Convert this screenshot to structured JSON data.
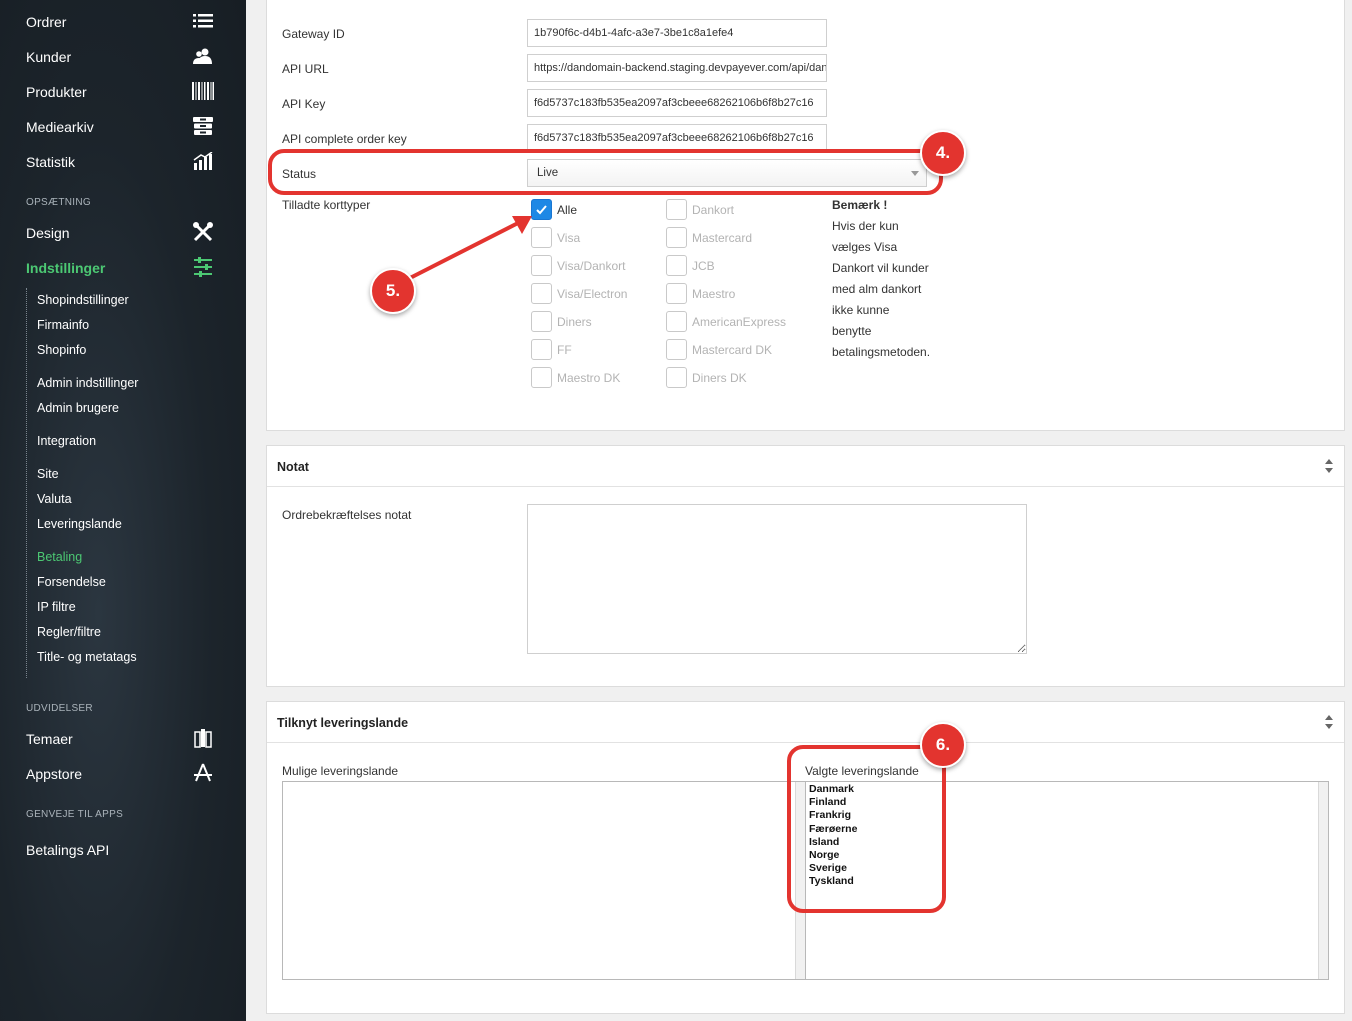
{
  "sidebar": {
    "main": [
      {
        "label": "Ordrer",
        "icon": "list-icon"
      },
      {
        "label": "Kunder",
        "icon": "users-icon"
      },
      {
        "label": "Produkter",
        "icon": "barcode-icon"
      },
      {
        "label": "Mediearkiv",
        "icon": "archive-icon"
      },
      {
        "label": "Statistik",
        "icon": "chart-icon"
      }
    ],
    "section_setup": "OPSÆTNING",
    "design": {
      "label": "Design",
      "icon": "tools-icon"
    },
    "settings": {
      "label": "Indstillinger",
      "icon": "sliders-icon"
    },
    "sub_items": [
      "Shopindstillinger",
      "Firmainfo",
      "Shopinfo",
      "Admin indstillinger",
      "Admin brugere",
      "Integration",
      "Site",
      "Valuta",
      "Leveringslande",
      "Betaling",
      "Forsendelse",
      "IP filtre",
      "Regler/filtre",
      "Title- og metatags"
    ],
    "section_ext": "UDVIDELSER",
    "themes": {
      "label": "Temaer",
      "icon": "theme-icon"
    },
    "appstore": {
      "label": "Appstore",
      "icon": "appstore-icon"
    },
    "section_shortcuts": "GENVEJE TIL APPS",
    "shortcut": "Betalings API",
    "accent": "#4cc873"
  },
  "gateway": {
    "fields": [
      {
        "label": "Gateway ID",
        "value": "1b790f6c-d4b1-4afc-a3e7-3be1c8a1efe4"
      },
      {
        "label": "API URL",
        "value": "https://dandomain-backend.staging.devpayever.com/api/dandomain"
      },
      {
        "label": "API Key",
        "value": "f6d5737c183fb535ea2097af3cbeee68262106b6f8b27c16"
      },
      {
        "label": "API complete order key",
        "value": "f6d5737c183fb535ea2097af3cbeee68262106b6f8b27c16"
      }
    ],
    "status_label": "Status",
    "status_value": "Live",
    "cards_label": "Tilladte korttyper",
    "cards_col1": [
      {
        "label": "Alle",
        "checked": true
      },
      {
        "label": "Visa",
        "checked": false
      },
      {
        "label": "Visa/Dankort",
        "checked": false
      },
      {
        "label": "Visa/Electron",
        "checked": false
      },
      {
        "label": "Diners",
        "checked": false
      },
      {
        "label": "FF",
        "checked": false
      },
      {
        "label": "Maestro DK",
        "checked": false
      }
    ],
    "cards_col2": [
      {
        "label": "Dankort",
        "checked": false
      },
      {
        "label": "Mastercard",
        "checked": false
      },
      {
        "label": "JCB",
        "checked": false
      },
      {
        "label": "Maestro",
        "checked": false
      },
      {
        "label": "AmericanExpress",
        "checked": false
      },
      {
        "label": "Mastercard DK",
        "checked": false
      },
      {
        "label": "Diners DK",
        "checked": false
      }
    ],
    "note_title": "Bemærk !",
    "note_lines": [
      "Hvis der kun",
      "vælges Visa",
      "Dankort vil kunder",
      "med alm dankort",
      "ikke kunne",
      "benytte",
      "betalingsmetoden."
    ]
  },
  "notat": {
    "title": "Notat",
    "field_label": "Ordrebekræftelses notat",
    "value": ""
  },
  "delivery": {
    "title": "Tilknyt leveringslande",
    "available_label": "Mulige leveringslande",
    "selected_label": "Valgte leveringslande",
    "available": [],
    "selected": [
      "Danmark",
      "Finland",
      "Frankrig",
      "Færøerne",
      "Island",
      "Norge",
      "Sverige",
      "Tyskland"
    ]
  },
  "annotations": {
    "badge4": "4.",
    "badge5": "5.",
    "badge6": "6.",
    "color": "#e3342f"
  }
}
